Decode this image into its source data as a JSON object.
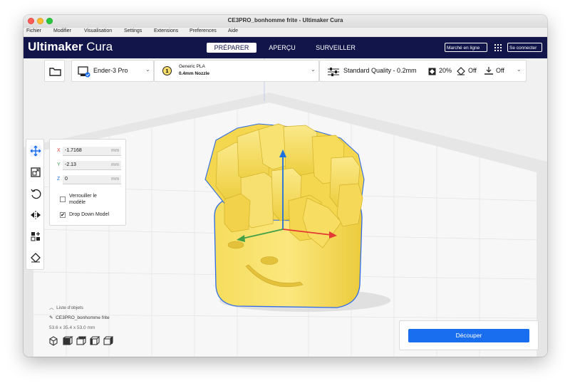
{
  "window": {
    "title": "CE3PRO_bonhomme frite - Ultimaker Cura"
  },
  "menu": [
    "Fichier",
    "Modifier",
    "Visualisation",
    "Settings",
    "Extensions",
    "Preferences",
    "Aide"
  ],
  "app": {
    "logo_bold": "Ultimaker",
    "logo_light": " Cura"
  },
  "stages": {
    "prepare": "PRÉPARER",
    "preview": "APERÇU",
    "monitor": "SURVEILLER"
  },
  "topbar": {
    "marketplace": "Marché en ligne",
    "login": "Se connecter"
  },
  "printer": {
    "name": "Ender-3 Pro",
    "extruder_number": "1",
    "material": "Generic PLA",
    "nozzle": "0.4mm Nozzle"
  },
  "print_settings": {
    "profile": "Standard Quality - 0.2mm",
    "infill": "20%",
    "support": "Off",
    "adhesion": "Off"
  },
  "move": {
    "x": {
      "label": "X",
      "value": "-1.7168",
      "unit": "mm"
    },
    "y": {
      "label": "Y",
      "value": "-2.13",
      "unit": "mm"
    },
    "z": {
      "label": "Z",
      "value": "0",
      "unit": "mm"
    },
    "lock_label": "Verrouiller le modèle",
    "lock_line1": "Verrouiller le",
    "lock_line2": "modèle",
    "drop_label": "Drop Down Model",
    "lock_checked": false,
    "drop_checked": true
  },
  "objects": {
    "header": "Liste d'objets",
    "item": "CE3PRO_bonhomme frite",
    "dimensions": "53.6 x 35.4 x 53.0 mm"
  },
  "slice": {
    "button": "Découper"
  },
  "colors": {
    "accent": "#196ef0",
    "header": "#11154a",
    "model": "#f7de6a",
    "x_axis": "#e53935",
    "y_axis": "#43a047",
    "z_axis": "#1e6fe0"
  },
  "icons": [
    "folder-icon",
    "printer-icon",
    "chevron-down-icon",
    "sliders-icon",
    "infill-icon",
    "support-icon",
    "adhesion-icon",
    "move-icon",
    "scale-icon",
    "rotate-icon",
    "mirror-icon",
    "per-model-settings-icon",
    "support-blocker-icon",
    "edit-icon",
    "grid-icon"
  ]
}
